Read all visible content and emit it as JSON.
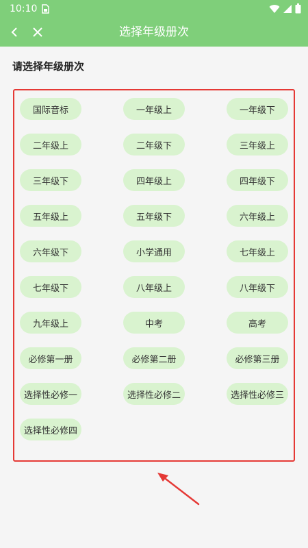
{
  "status": {
    "time": "10:10"
  },
  "toolbar": {
    "title": "选择年级册次"
  },
  "section_title": "请选择年级册次",
  "grades": [
    "国际音标",
    "一年级上",
    "一年级下",
    "二年级上",
    "二年级下",
    "三年级上",
    "三年级下",
    "四年级上",
    "四年级下",
    "五年级上",
    "五年级下",
    "六年级上",
    "六年级下",
    "小学通用",
    "七年级上",
    "七年级下",
    "八年级上",
    "八年级下",
    "九年级上",
    "中考",
    "高考",
    "必修第一册",
    "必修第二册",
    "必修第三册",
    "选择性必修一",
    "选择性必修二",
    "选择性必修三",
    "选择性必修四"
  ],
  "colors": {
    "toolbar": "#7fcf7a",
    "pill": "#d9f3cf",
    "highlight": "#e53935"
  }
}
